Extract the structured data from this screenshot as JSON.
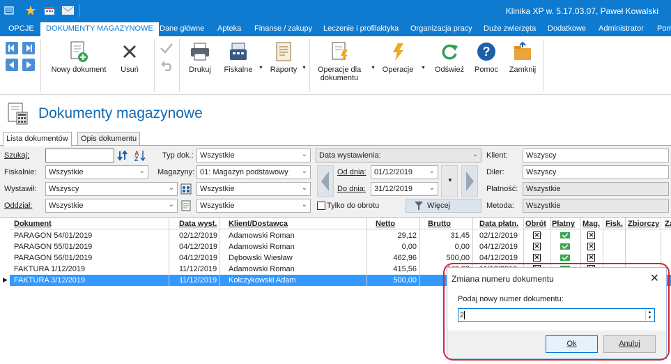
{
  "app": {
    "title": "Klinika XP w. 5.17.03.07, Paweł Kowalski",
    "accent": "#0f7bd0"
  },
  "quick_access": [
    "app-menu-icon",
    "star-icon",
    "calendar-icon",
    "mail-icon"
  ],
  "menu": {
    "items": [
      "OPCJE",
      "DOKUMENTY MAGAZYNOWE",
      "Dane główne",
      "Apteka",
      "Finanse / zakupy",
      "Leczenie i profilaktyka",
      "Organizacja pracy",
      "Duże zwierzęta",
      "Dodatkowe",
      "Administrator",
      "Pom"
    ]
  },
  "ribbon": {
    "new_doc": "Nowy dokument",
    "delete": "Usuń",
    "print": "Drukuj",
    "fiscal": "Fiskalne",
    "reports": "Raporty",
    "doc_ops_1": "Operacje dla",
    "doc_ops_2": "dokumentu",
    "ops": "Operacje",
    "refresh": "Odśwież",
    "help": "Pomoc",
    "close": "Zamknij"
  },
  "page": {
    "title": "Dokumenty magazynowe"
  },
  "tabs": [
    "Lista dokumentów",
    "Opis dokumentu"
  ],
  "filters": {
    "search_label": "Szukaj:",
    "search_value": "",
    "doc_type_label": "Typ dok.:",
    "doc_type_value": "Wszystkie",
    "date_field_value": "Data wystawienia:",
    "client_label": "Klient:",
    "client_value": "Wszyscy",
    "fiscal_label": "Fiskalnie:",
    "fiscal_value": "Wszystkie",
    "warehouse_label": "Magazyny:",
    "warehouse_value": "01: Magazyn podstawowy",
    "from_label": "Od dnia:",
    "from_value": "01/12/2019",
    "dealer_label": "Diler:",
    "dealer_value": "Wszyscy",
    "issued_label": "Wystawił:",
    "issued_value": "Wszyscy",
    "extra1_value": "Wszystkie",
    "to_label": "Do dnia:",
    "to_value": "31/12/2019",
    "payment_label": "Płatność:",
    "payment_value": "Wszystkie",
    "branch_label": "Oddział:",
    "branch_value": "Wszystkie",
    "extra2_value": "Wszystkie",
    "only_turnover_label": "Tylko do obrotu",
    "more_label": "Więcej",
    "method_label": "Metoda:",
    "method_value": "Wszystkie"
  },
  "grid": {
    "columns": [
      "Dokument",
      "Data wyst.",
      "Klient/Dostawca",
      "Netto",
      "Brutto",
      "Data płatn.",
      "Obrót",
      "Płatny",
      "Mag.",
      "Fisk.",
      "Zbiorczy",
      "Za"
    ],
    "rows": [
      {
        "doc": "PARAGON 54/01/2019",
        "date": "02/12/2019",
        "client": "Adamowski Roman",
        "net": "29,12",
        "gross": "31,45",
        "paydate": "02/12/2019",
        "turnover": true,
        "paid": true,
        "mag": true
      },
      {
        "doc": "PARAGON 55/01/2019",
        "date": "04/12/2019",
        "client": "Adamowski Roman",
        "net": "0,00",
        "gross": "0,00",
        "paydate": "04/12/2019",
        "turnover": true,
        "paid": true,
        "mag": true
      },
      {
        "doc": "PARAGON 56/01/2019",
        "date": "04/12/2019",
        "client": "Dębowski Wiesław",
        "net": "462,96",
        "gross": "500,00",
        "paydate": "04/12/2019",
        "turnover": true,
        "paid": true,
        "mag": true
      },
      {
        "doc": "FAKTURA 1/12/2019",
        "date": "11/12/2019",
        "client": "Adamowski Roman",
        "net": "415,56",
        "gross": "448,80",
        "paydate": "11/12/2019",
        "turnover": true,
        "paid": true,
        "mag": true
      },
      {
        "doc": "FAKTURA 3/12/2019",
        "date": "11/12/2019",
        "client": "Kołczykowski Adam",
        "net": "500,00",
        "gross": "",
        "paydate": "",
        "turnover": false,
        "paid": false,
        "mag": false
      }
    ],
    "selected_row": 4
  },
  "dialog": {
    "title": "Zmiana numeru dokumentu",
    "prompt": "Podaj nowy numer dokumentu:",
    "value": "2",
    "ok": "Ok",
    "cancel": "Anuluj"
  }
}
